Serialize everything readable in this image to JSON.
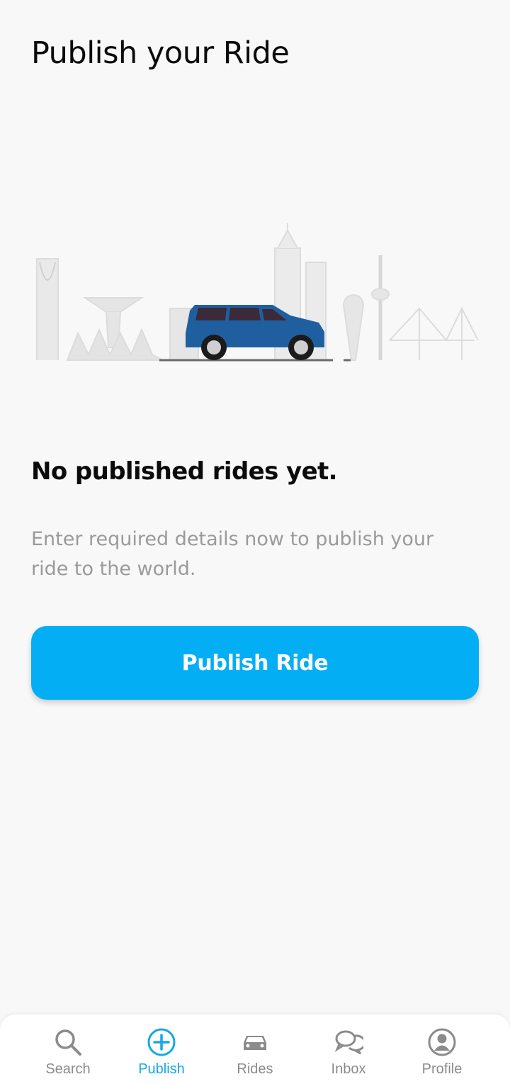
{
  "header": {
    "title": "Publish your Ride"
  },
  "empty_state": {
    "heading": "No published rides yet.",
    "description": "Enter required details now to publish your ride to the world.",
    "button_label": "Publish Ride"
  },
  "colors": {
    "accent": "#04aef5",
    "nav_active": "#14a8e6",
    "nav_inactive": "#8b8b8b",
    "car": "#1f5fa0"
  },
  "bottom_nav": {
    "items": [
      {
        "label": "Search",
        "icon": "search-icon",
        "active": false
      },
      {
        "label": "Publish",
        "icon": "plus-circle-icon",
        "active": true
      },
      {
        "label": "Rides",
        "icon": "car-icon",
        "active": false
      },
      {
        "label": "Inbox",
        "icon": "chat-bubbles-icon",
        "active": false
      },
      {
        "label": "Profile",
        "icon": "profile-icon",
        "active": false
      }
    ]
  }
}
